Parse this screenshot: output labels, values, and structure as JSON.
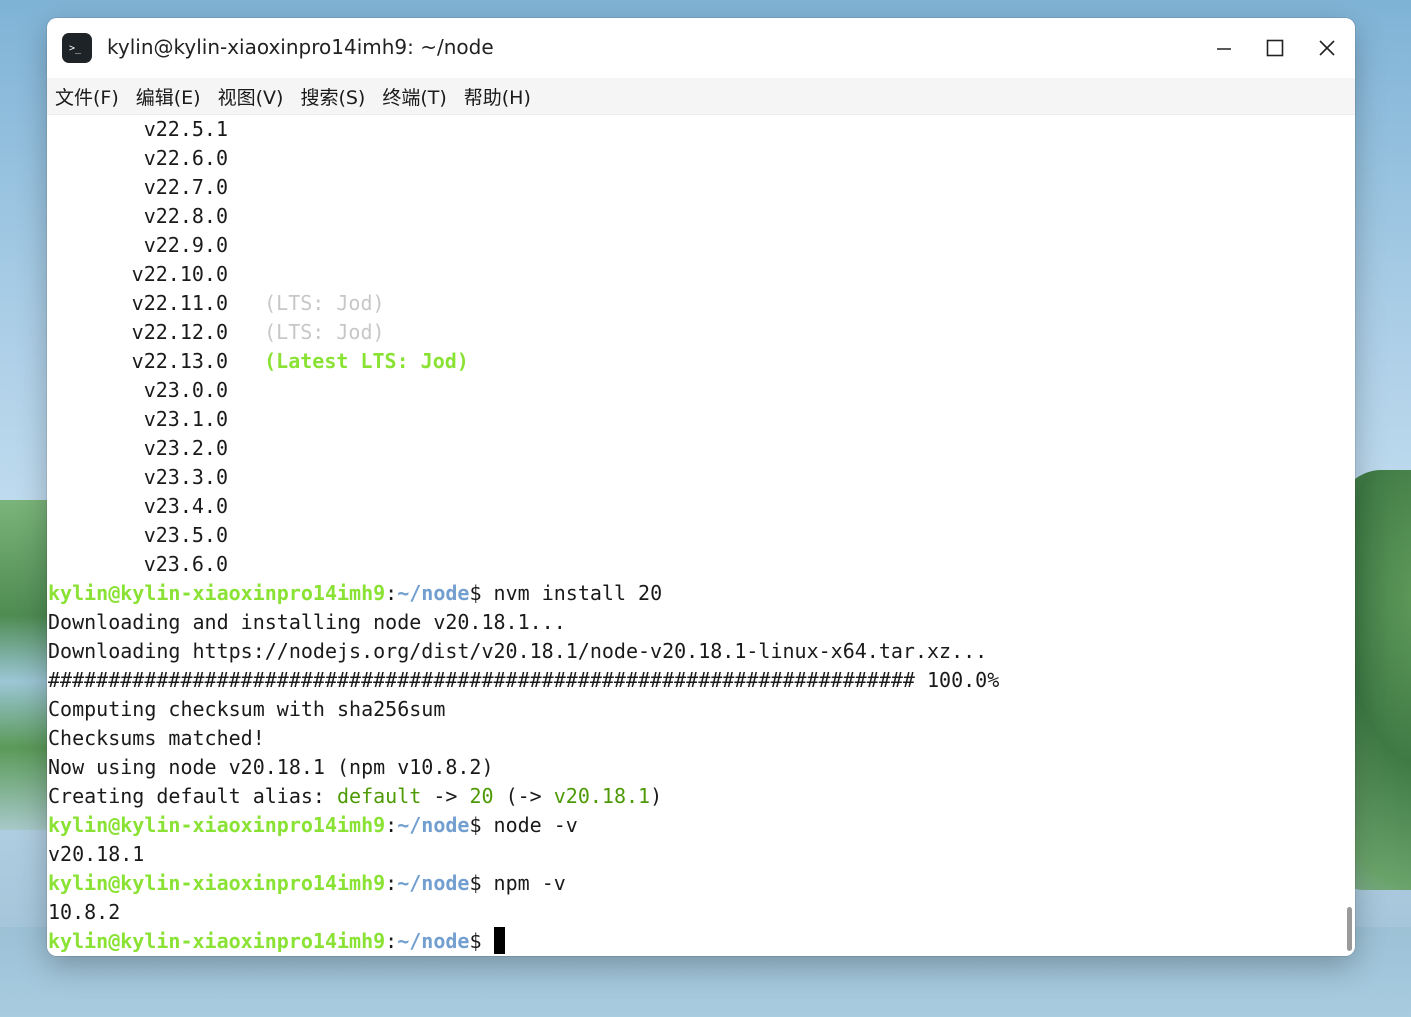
{
  "window": {
    "title": "kylin@kylin-xiaoxinpro14imh9: ~/node",
    "icon": "terminal-icon",
    "app_icon_glyph": ">_"
  },
  "menu": [
    "文件(F)",
    "编辑(E)",
    "视图(V)",
    "搜索(S)",
    "终端(T)",
    "帮助(H)"
  ],
  "versions": [
    {
      "v": "v22.5.1",
      "tag": ""
    },
    {
      "v": "v22.6.0",
      "tag": ""
    },
    {
      "v": "v22.7.0",
      "tag": ""
    },
    {
      "v": "v22.8.0",
      "tag": ""
    },
    {
      "v": "v22.9.0",
      "tag": ""
    },
    {
      "v": "v22.10.0",
      "tag": ""
    },
    {
      "v": "v22.11.0",
      "tag": "(LTS: Jod)"
    },
    {
      "v": "v22.12.0",
      "tag": "(LTS: Jod)"
    },
    {
      "v": "v22.13.0",
      "tag": "(Latest LTS: Jod)"
    },
    {
      "v": "v23.0.0",
      "tag": ""
    },
    {
      "v": "v23.1.0",
      "tag": ""
    },
    {
      "v": "v23.2.0",
      "tag": ""
    },
    {
      "v": "v23.3.0",
      "tag": ""
    },
    {
      "v": "v23.4.0",
      "tag": ""
    },
    {
      "v": "v23.5.0",
      "tag": ""
    },
    {
      "v": "v23.6.0",
      "tag": ""
    }
  ],
  "prompt": {
    "user": "kylin@kylin-xiaoxinpro14imh9",
    "sep": ":",
    "path": "~/node",
    "symbol": "$"
  },
  "commands": [
    "nvm install 20",
    "node -v",
    "npm -v"
  ],
  "output": {
    "downloading_node": "Downloading and installing node v20.18.1...",
    "downloading_url": "Downloading https://nodejs.org/dist/v20.18.1/node-v20.18.1-linux-x64.tar.xz...",
    "progress_bar": "######################################################################## 100.0%",
    "checksum": "Computing checksum with sha256sum",
    "matched": "Checksums matched!",
    "now_using": "Now using node v20.18.1 (npm v10.8.2)",
    "alias_prefix": "Creating default alias: ",
    "alias_name": "default",
    "alias_arrow": " -> ",
    "alias_target": "20",
    "alias_paren_open": " (-> ",
    "alias_resolved": "v20.18.1",
    "alias_paren_close": ")",
    "node_version": "v20.18.1",
    "npm_version": "10.8.2"
  },
  "colors": {
    "prompt_user": "#8ae234",
    "prompt_path": "#729fcf",
    "lts_gray": "#c7c7c7",
    "alias_green": "#4e9a06"
  }
}
